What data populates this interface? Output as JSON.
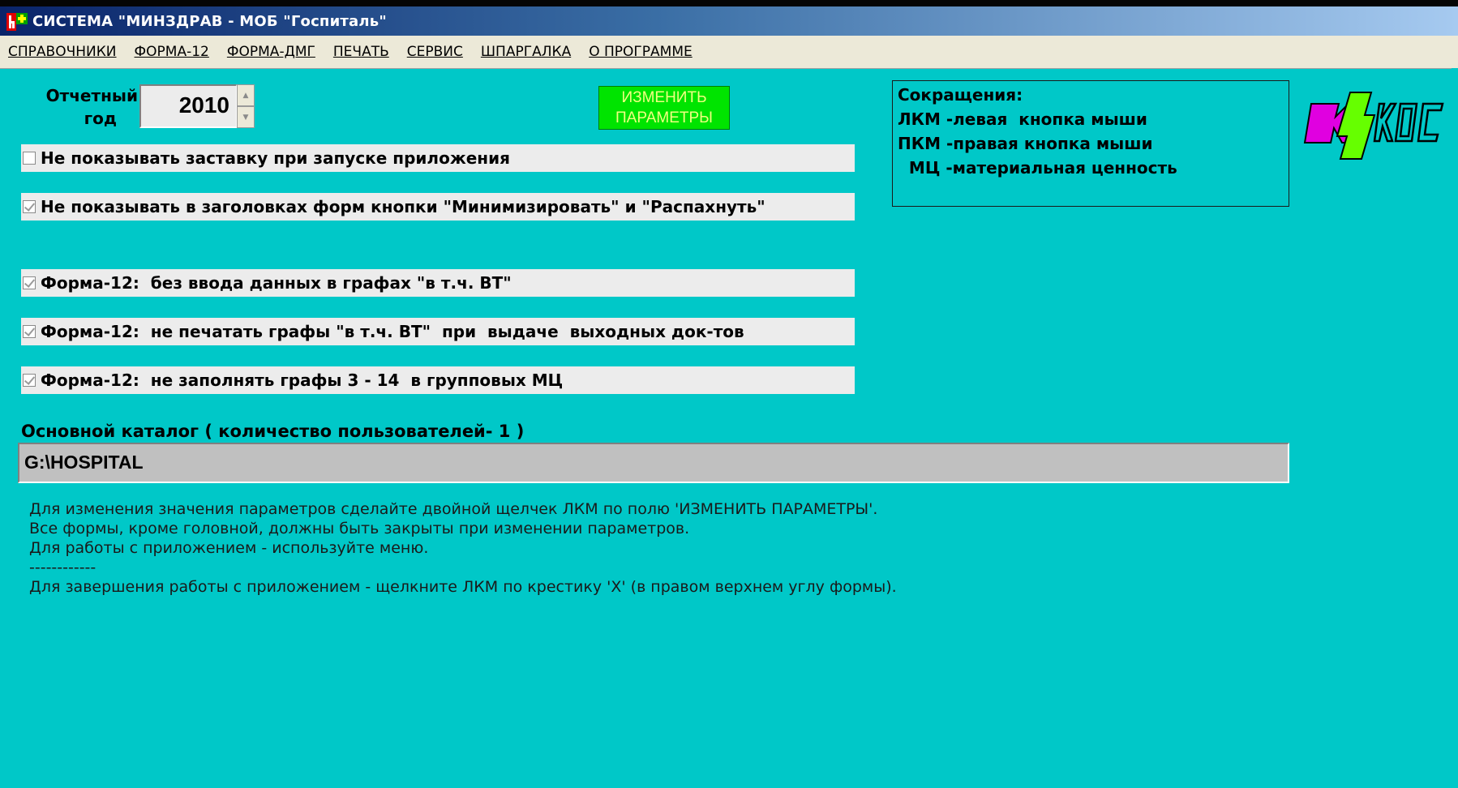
{
  "window": {
    "title": "СИСТЕМА \"МИНЗДРАВ - МОБ \"Госпиталь\""
  },
  "menu": {
    "items": [
      {
        "label": "СПРАВОЧНИКИ"
      },
      {
        "label": "ФОРМА-12"
      },
      {
        "label": "ФОРМА-ДМГ"
      },
      {
        "label": "ПЕЧАТЬ"
      },
      {
        "label": "СЕРВИС"
      },
      {
        "label": "ШПАРГАЛКА"
      },
      {
        "label": "О ПРОГРАММЕ"
      }
    ]
  },
  "year": {
    "label_line1": "Отчетный",
    "label_line2": "год",
    "value": "2010"
  },
  "change_button": {
    "line1": "ИЗМЕНИТЬ",
    "line2": "ПАРАМЕТРЫ"
  },
  "options": [
    {
      "label": "Не показывать заставку при запуске приложения",
      "checked": false
    },
    {
      "label": "Не показывать в заголовках форм кнопки \"Минимизировать\" и \"Распахнуть\"",
      "checked": true
    },
    {
      "label": "Форма-12:  без ввода данных в графах \"в т.ч. ВТ\"",
      "checked": true
    },
    {
      "label": "Форма-12:  не печатать графы \"в т.ч. ВТ\"  при  выдаче  выходных док-тов",
      "checked": true
    },
    {
      "label": "Форма-12:  не заполнять графы 3 - 14  в групповых МЦ",
      "checked": true
    }
  ],
  "abbreviations": {
    "title": "Сокращения:",
    "lines": [
      "ЛКМ -левая  кнопка мыши",
      "ПКМ -правая кнопка мыши",
      "  МЦ -материальная ценность"
    ]
  },
  "catalog": {
    "label": "Основной каталог ( количество пользователей- 1 )",
    "value": "G:\\HOSPITAL"
  },
  "help": {
    "lines": [
      "Для изменения значения параметров сделайте двойной щелчек ЛКМ по полю 'ИЗМЕНИТЬ ПАРАМЕТРЫ'.",
      "Все формы, кроме головной, должны быть закрыты при изменении параметров.",
      "Для работы с приложением - используйте меню.",
      "------------",
      "Для завершения работы с приложением - щелкните ЛКМ по крестику 'X' (в правом верхнем углу формы)."
    ]
  },
  "colors": {
    "background": "#00c8c8",
    "change_button_bg": "#00e400",
    "change_button_text": "#f0ff80",
    "logo_magenta": "#e000e0",
    "logo_green": "#66ff00"
  }
}
